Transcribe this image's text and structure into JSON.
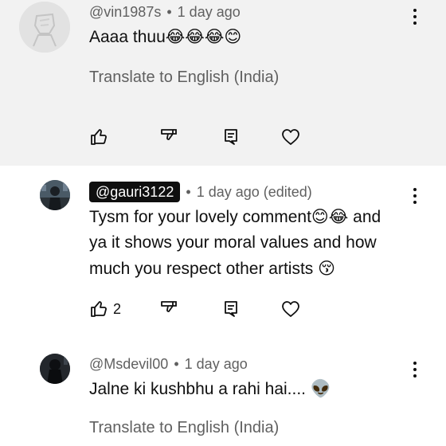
{
  "comments": [
    {
      "handle": "@vin1987s",
      "time": "1 day ago",
      "text": "Aaaa thuu",
      "emojis": "😂😂😂😊",
      "translate": "Translate to English (India)",
      "like_count": "",
      "avatar_icon": "default-avatar-icon"
    },
    {
      "handle": "@gauri3122",
      "time": "1 day ago (edited)",
      "text_line1": "Tysm for your lovely comment",
      "emojis_line1": "😊😂",
      "text_line1_end": " and",
      "text_line2": "ya it shows your moral values and how",
      "text_line3": "much you respect other artists ",
      "emojis_line3": "😚",
      "like_count": "2",
      "avatar_icon": "user-photo-avatar"
    },
    {
      "handle": "@Msdevil00",
      "time": "1 day ago",
      "text": "Jalne ki kushbhu a rahi hai.... ",
      "emojis": "👽",
      "translate": "Translate to English (India)",
      "avatar_icon": "user-photo-avatar"
    }
  ],
  "separator": "•",
  "colors": {
    "highlight_bg": "#f2f2f2",
    "secondary_text": "#606060",
    "primary_text": "#0f0f0f",
    "chip_bg": "#0f0f0f"
  }
}
